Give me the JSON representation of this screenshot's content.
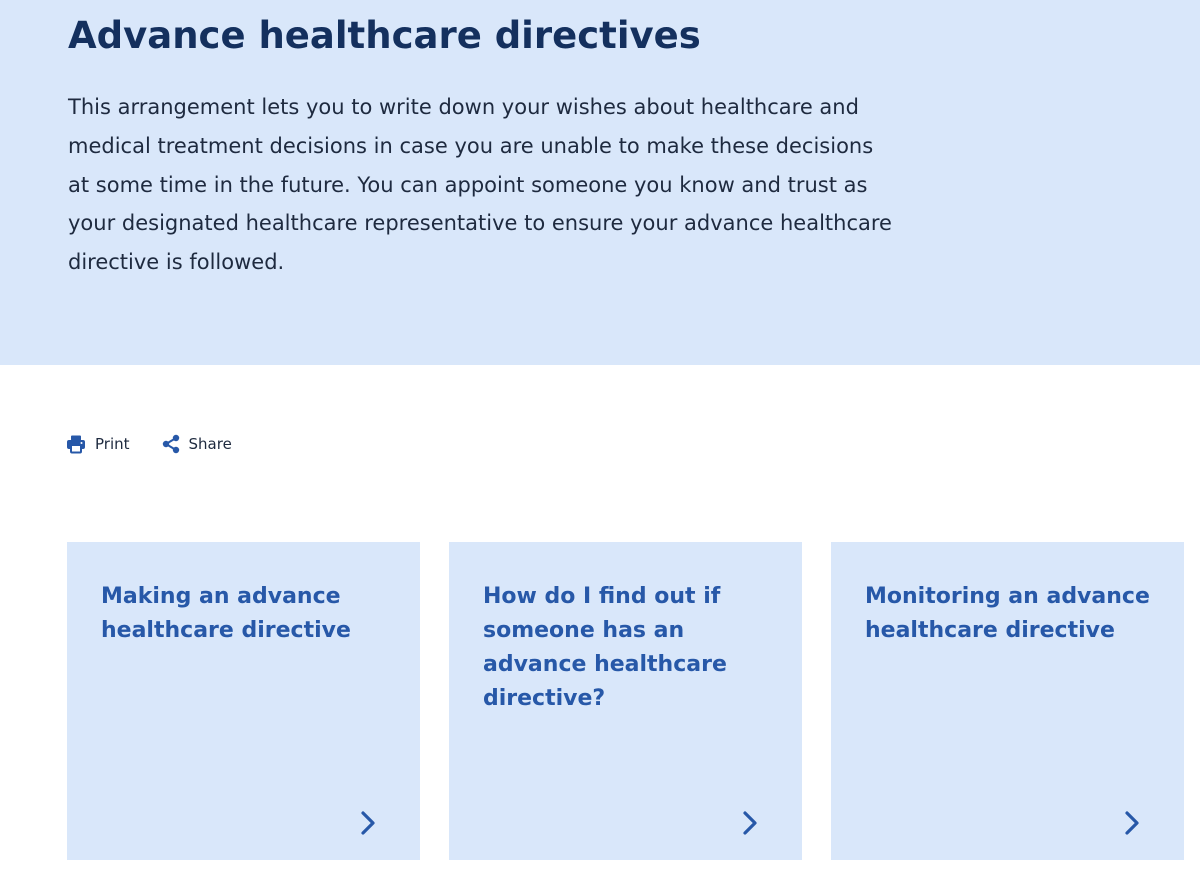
{
  "hero": {
    "title": "Advance healthcare directives",
    "description": "This arrangement lets you to write down your wishes about healthcare and medical treatment decisions in case you are unable to make these decisions at some time in the future. You can appoint someone you know and trust as your designated healthcare representative to ensure your advance healthcare directive is followed."
  },
  "actions": {
    "print_label": "Print",
    "share_label": "Share",
    "print_icon": "printer-icon",
    "share_icon": "share-icon"
  },
  "cards": [
    {
      "title": "Making an advance healthcare directive",
      "icon": "chevron-right-icon"
    },
    {
      "title": "How do I find out if someone has an advance healthcare directive?",
      "icon": "chevron-right-icon"
    },
    {
      "title": "Monitoring an advance healthcare directive",
      "icon": "chevron-right-icon"
    }
  ],
  "colors": {
    "panel_background": "#d9e7fa",
    "title_dark_blue": "#14305e",
    "link_blue": "#2758a8",
    "body_text": "#1e2a3f"
  }
}
